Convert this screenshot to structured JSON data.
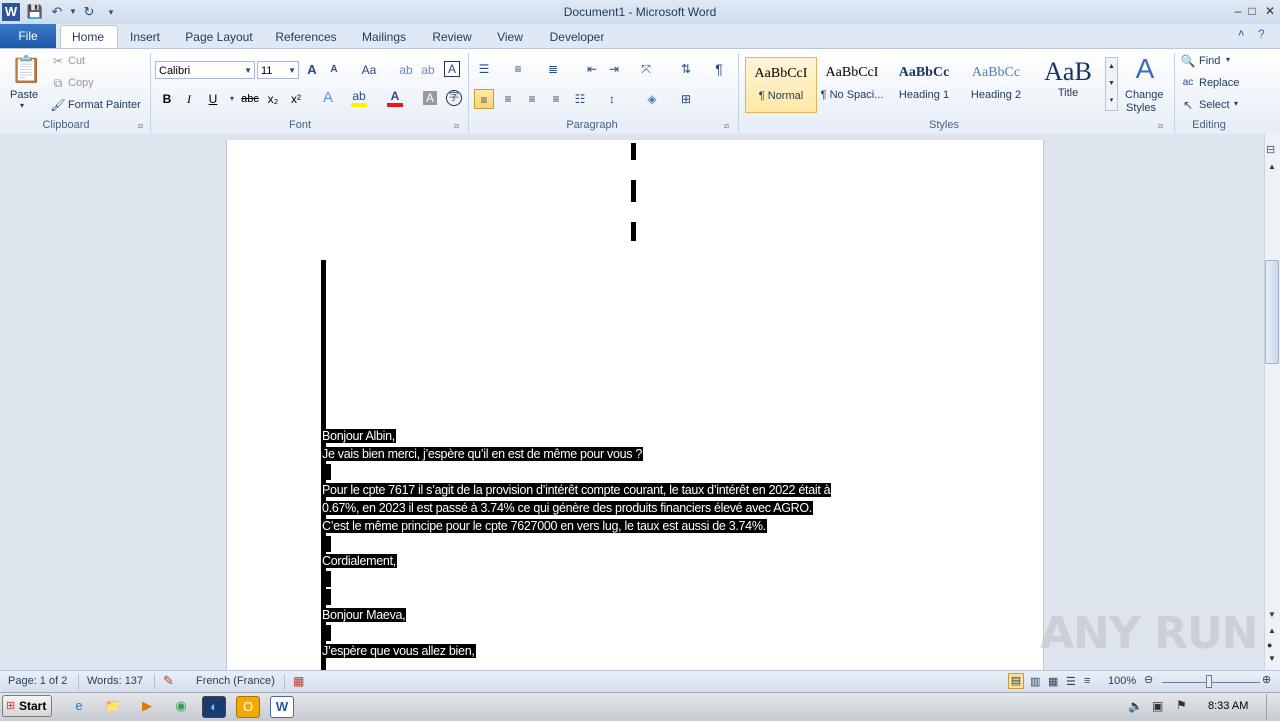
{
  "window": {
    "title": "Document1 - Microsoft Word",
    "app_icon": "W",
    "minimize": "–",
    "maximize": "□",
    "close": "✕"
  },
  "tabs": [
    "File",
    "Home",
    "Insert",
    "Page Layout",
    "References",
    "Mailings",
    "Review",
    "View",
    "Developer"
  ],
  "clipboard": {
    "paste": "Paste",
    "cut": "Cut",
    "copy": "Copy",
    "format_painter": "Format Painter",
    "label": "Clipboard"
  },
  "font": {
    "name": "Calibri",
    "size": "11",
    "label": "Font",
    "bold": "B",
    "italic": "I",
    "underline": "U",
    "strike": "abc",
    "subscript": "x₂",
    "superscript": "x²",
    "grow": "A",
    "shrink": "A",
    "change_case": "Aa"
  },
  "paragraph": {
    "label": "Paragraph",
    "pilcrow": "¶"
  },
  "styles": {
    "label": "Styles",
    "items": [
      {
        "sample": "AaBbCcI",
        "name": "¶ Normal"
      },
      {
        "sample": "AaBbCcI",
        "name": "¶ No Spaci..."
      },
      {
        "sample": "AaBbCc",
        "name": "Heading 1"
      },
      {
        "sample": "AaBbCc",
        "name": "Heading 2"
      },
      {
        "sample": "AaB",
        "name": "Title"
      }
    ],
    "change_styles": [
      "Change",
      "Styles"
    ]
  },
  "editing": {
    "label": "Editing",
    "find": "Find",
    "replace": "Replace",
    "select": "Select"
  },
  "document": {
    "lines": [
      "Bonjour Albin,",
      "Je vais bien merci, j’espère qu’il en est de même pour vous ?",
      "",
      "Pour le cpte 7617  il s’agit de la provision d’intérêt compte courant, le taux d’intérêt en 2022 était à",
      "0.67%, en 2023  il est passé à 3.74%  ce qui génère des produits financiers élevé avec AGRO.",
      "C’est le même principe pour le cpte 7627000  en vers lug, le taux est aussi de 3.74%.",
      "",
      "Cordialement,",
      "",
      "",
      "Bonjour Maeva,",
      "",
      "J’espère que vous allez bien,"
    ]
  },
  "status": {
    "page": "Page: 1 of 2",
    "words": "Words: 137",
    "language": "French (France)",
    "zoom": "100%"
  },
  "taskbar": {
    "start": "Start",
    "time": "8:33 AM"
  },
  "watermark": "ANY RUN"
}
